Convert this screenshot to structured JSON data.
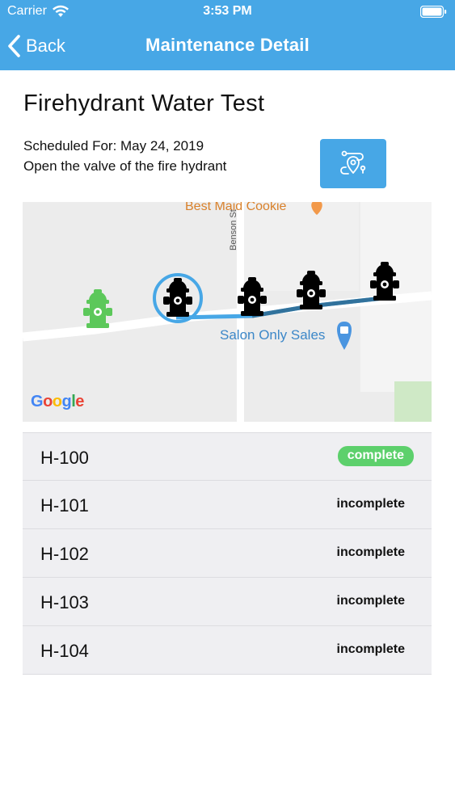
{
  "status_bar": {
    "carrier": "Carrier",
    "time": "3:53 PM"
  },
  "nav": {
    "back_label": "Back",
    "title": "Maintenance Detail"
  },
  "task": {
    "title": "Firehydrant Water Test",
    "scheduled": "Scheduled For: May 24, 2019",
    "description": "Open the valve of the fire hydrant"
  },
  "route_button": {
    "icon": "route-map-pin-icon"
  },
  "map": {
    "places": {
      "cookie": "Best Maid Cookie",
      "salon": "Salon Only Sales",
      "street": "Benson St"
    },
    "logo": [
      "G",
      "o",
      "o",
      "g",
      "l",
      "e"
    ]
  },
  "hydrants": [
    {
      "id": "H-100",
      "status": "complete"
    },
    {
      "id": "H-101",
      "status": "incomplete"
    },
    {
      "id": "H-102",
      "status": "incomplete"
    },
    {
      "id": "H-103",
      "status": "incomplete"
    },
    {
      "id": "H-104",
      "status": "incomplete"
    }
  ],
  "colors": {
    "accent": "#47a7e6",
    "complete": "#5dd06c",
    "hydrant_done": "#5cc85a",
    "hydrant_pending": "#000000"
  }
}
